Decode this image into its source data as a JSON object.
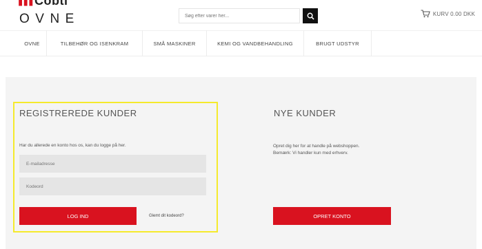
{
  "brand": {
    "logo_top": "Cobti",
    "logo_bottom": "OVNE",
    "accent_color": "#d9121f"
  },
  "search": {
    "placeholder": "Søg efter varer her...",
    "button_icon": "search-icon"
  },
  "cart": {
    "icon": "cart-icon",
    "label": "KURV 0.00 DKK"
  },
  "nav": {
    "items": [
      {
        "label": "OVNE"
      },
      {
        "label": "TILBEHØR OG ISENKRAM"
      },
      {
        "label": "SMÅ MASKINER"
      },
      {
        "label": "KEMI OG VANDBEHANDLING"
      },
      {
        "label": "BRUGT UDSTYR"
      }
    ]
  },
  "login": {
    "title": "REGISTREREDE KUNDER",
    "text": "Har du allerede en konto hos os, kan du logge på her.",
    "email_placeholder": "E-mailadresse",
    "password_placeholder": "Kodeord",
    "button_label": "LOG IND",
    "forgot_label": "Glemt dit kodeord?",
    "highlight_color": "#f5ea2b"
  },
  "new_customers": {
    "title": "NYE KUNDER",
    "text_line1": "Opret dig her for at handle på webshoppen.",
    "text_line2": "Bemærk: Vi handler kun med erhverv.",
    "button_label": "OPRET KONTO"
  }
}
